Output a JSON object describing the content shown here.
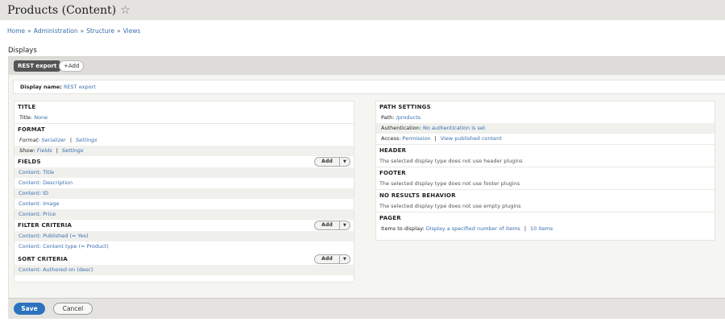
{
  "header": {
    "title": "Products (Content)",
    "star_icon": "☆"
  },
  "breadcrumb": [
    "Home",
    "Administration",
    "Structure",
    "Views"
  ],
  "breadcrumb_sep": "»",
  "displays_label": "Displays",
  "tabs": {
    "active": "REST export",
    "add": "+Add"
  },
  "display_name": {
    "label": "Display name:",
    "value": "REST export"
  },
  "left": {
    "title": {
      "heading": "TITLE",
      "label": "Title:",
      "value": "None"
    },
    "format": {
      "heading": "FORMAT",
      "format_label": "Format:",
      "format_value": "Serializer",
      "format_settings": "Settings",
      "show_label": "Show:",
      "show_value": "Fields",
      "show_settings": "Settings"
    },
    "fields": {
      "heading": "FIELDS",
      "items": [
        "Content: Title",
        "Content: Description",
        "Content: ID",
        "Content: Image",
        "Content: Price"
      ]
    },
    "filter": {
      "heading": "FILTER CRITERIA",
      "items": [
        "Content: Published (= Yes)",
        "Content: Content type (= Product)"
      ]
    },
    "sort": {
      "heading": "SORT CRITERIA",
      "items": [
        "Content: Authored on (desc)"
      ]
    },
    "add_label": "Add",
    "caret": "▼"
  },
  "right": {
    "path_settings": {
      "heading": "PATH SETTINGS",
      "path_label": "Path:",
      "path_value": "/products",
      "auth_label": "Authentication:",
      "auth_value": "No authentication is set",
      "access_label": "Access:",
      "access_value": "Permission",
      "access_extra": "View published content"
    },
    "header": {
      "heading": "HEADER",
      "note": "The selected display type does not use header plugins"
    },
    "footer": {
      "heading": "FOOTER",
      "note": "The selected display type does not use footer plugins"
    },
    "no_results": {
      "heading": "NO RESULTS BEHAVIOR",
      "note": "The selected display type does not use empty plugins"
    },
    "pager": {
      "heading": "PAGER",
      "label": "Items to display:",
      "value": "Display a specified number of items",
      "extra": "10 items"
    }
  },
  "actions": {
    "save": "Save",
    "cancel": "Cancel"
  },
  "colors": {
    "link": "#3a6fb0",
    "save_button": "#2b73bd",
    "active_tab": "#555555"
  }
}
